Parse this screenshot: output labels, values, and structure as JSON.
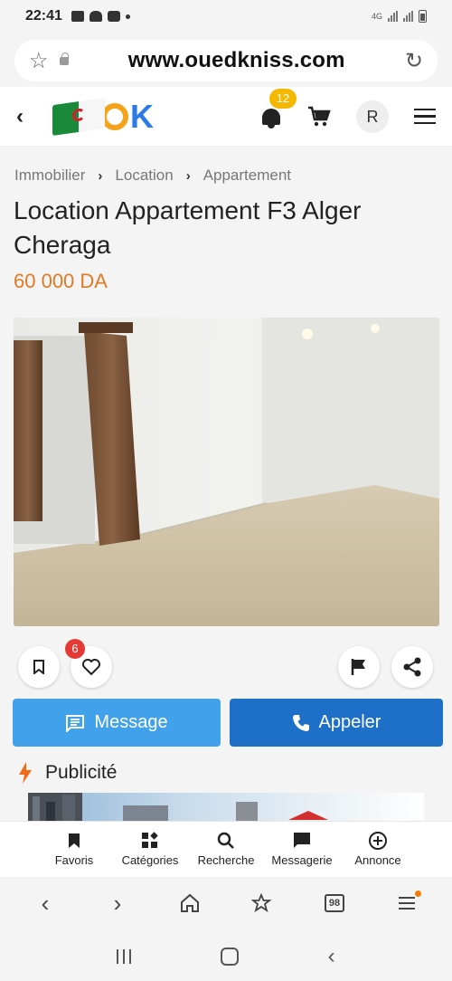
{
  "status_bar": {
    "time": "22:41",
    "network": "4G"
  },
  "browser": {
    "url": "www.ouedkniss.com",
    "tabs_count": "98"
  },
  "header": {
    "notification_count": "12",
    "avatar_initial": "R"
  },
  "breadcrumb": [
    "Immobilier",
    "Location",
    "Appartement"
  ],
  "listing": {
    "title": "Location Appartement F3 Alger Cheraga",
    "price": "60 000 DA",
    "favorites_count": "6"
  },
  "buttons": {
    "message": "Message",
    "call": "Appeler"
  },
  "ad_section": {
    "label": "Publicité"
  },
  "app_nav": [
    {
      "label": "Favoris",
      "icon": "bookmark-icon"
    },
    {
      "label": "Catégories",
      "icon": "categories-icon"
    },
    {
      "label": "Recherche",
      "icon": "search-icon"
    },
    {
      "label": "Messagerie",
      "icon": "chat-icon"
    },
    {
      "label": "Annonce",
      "icon": "add-circle-icon"
    }
  ],
  "colors": {
    "price": "#e07a23",
    "message_button": "#41a1ea",
    "call_button": "#1e6fc7",
    "notification_badge": "#f5b800",
    "favorite_badge": "#e53935",
    "brand_blue": "#2c7be5",
    "brand_orange": "#f5a31a"
  }
}
